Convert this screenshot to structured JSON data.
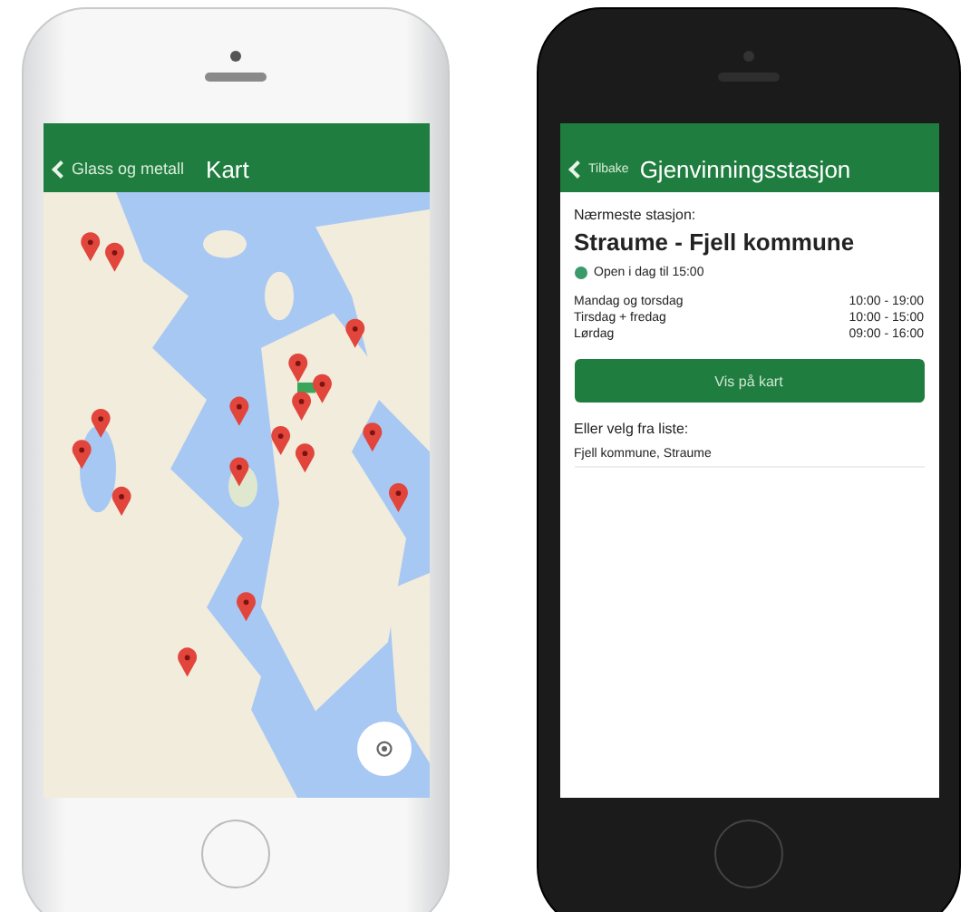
{
  "map_screen": {
    "back_label": "Glass og metall",
    "title": "Kart"
  },
  "station_screen": {
    "back_label": "Tilbake",
    "title": "Gjenvinningsstasjon",
    "nearest_label": "Nærmeste stasjon:",
    "station_name": "Straume - Fjell kommune",
    "open_status": {
      "text": "Open i dag til 15:00",
      "open": true
    },
    "hours": [
      {
        "days": "Mandag og torsdag",
        "time": "10:00 - 19:00"
      },
      {
        "days": "Tirsdag + fredag",
        "time": "10:00 - 15:00"
      },
      {
        "days": "Lørdag",
        "time": "09:00 - 16:00"
      }
    ],
    "map_button": "Vis på kart",
    "list_label": "Eller velg fra liste:",
    "list_items": [
      "Fjell kommune, Straume"
    ]
  }
}
